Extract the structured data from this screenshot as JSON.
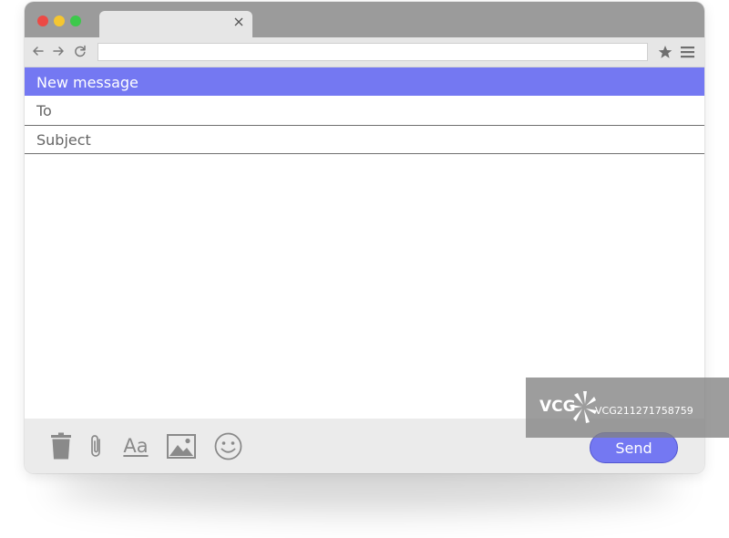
{
  "browser": {
    "traffic_lights": [
      "#ec4a45",
      "#f5c630",
      "#3cc94b"
    ],
    "address_value": "",
    "icons": [
      "back-arrow-icon",
      "forward-arrow-icon",
      "reload-icon",
      "star-icon",
      "menu-icon",
      "close-icon"
    ]
  },
  "compose": {
    "header_title": "New message",
    "to_placeholder": "To",
    "subject_placeholder": "Subject",
    "body_value": "",
    "accent_color": "#7478f2"
  },
  "toolbar": {
    "icons": [
      "trash-icon",
      "paperclip-icon",
      "image-icon",
      "smiley-icon"
    ],
    "format_label": "Aa",
    "send_label": "Send"
  },
  "watermark": {
    "brand": "VCG",
    "id": "VCG211271758759"
  }
}
